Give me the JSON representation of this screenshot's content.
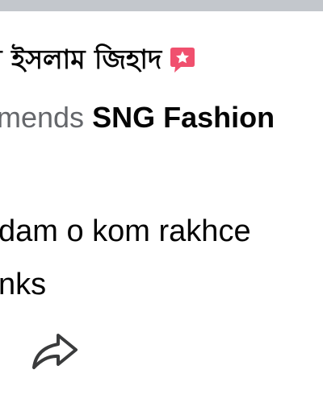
{
  "post": {
    "author_name": "ল ইসলাম জিহাদ",
    "recommend_verb": "mends",
    "page_name": "SNG Fashion"
  },
  "review": {
    "lines": [
      "dam o kom rakhce",
      "nks"
    ]
  },
  "icons": {
    "badge": "pink-speech-bubble-star-icon",
    "share": "share-arrow-icon"
  },
  "colors": {
    "badge": "#f0506e",
    "muted_text": "#65676b",
    "primary_text": "#050505",
    "top_bar": "#c3c7cc"
  }
}
